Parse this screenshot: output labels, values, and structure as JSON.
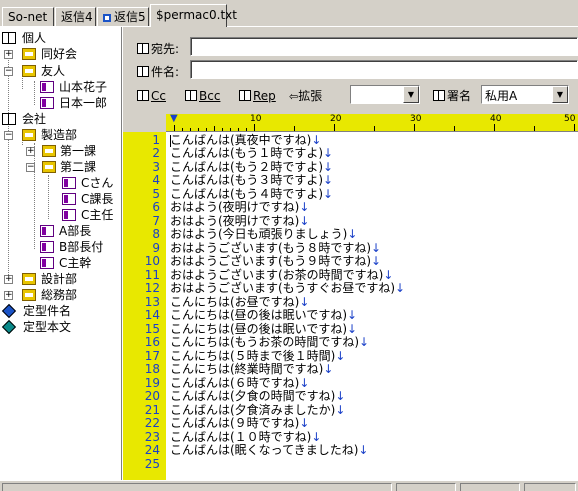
{
  "tabs": [
    {
      "label": "So-net",
      "icon": null
    },
    {
      "label": "返信4",
      "icon": null
    },
    {
      "label": "返信5",
      "icon": "mail-icon"
    },
    {
      "label": "$permac0.txt",
      "icon": null
    }
  ],
  "tree": {
    "personal": "個人",
    "friends_group": "同好会",
    "friend": "友人",
    "yamamoto": "山本花子",
    "nihon": "日本一郎",
    "company": "会社",
    "manufacturing": "製造部",
    "section1": "第一課",
    "section2": "第二課",
    "c_san": "Cさん",
    "c_chief": "C課長",
    "c_lead": "C主任",
    "a_manager": "A部長",
    "b_deputy": "B部長付",
    "c_exec": "C主幹",
    "design": "設計部",
    "general_affairs": "総務部",
    "fixed_subject": "定型件名",
    "fixed_body": "定型本文"
  },
  "header": {
    "to_label": "宛先:",
    "to_value": "",
    "subject_label": "件名:",
    "subject_value": "",
    "cc_label": "Cc",
    "bcc_label": "Bcc",
    "rep_label": "Rep",
    "extend_label": "拡張",
    "extend_value": "",
    "signature_label": "署名",
    "signature_value": "私用A"
  },
  "ruler": {
    "marks": [
      "10",
      "20",
      "30",
      "40",
      "50"
    ]
  },
  "editor": {
    "lines": [
      "こんばんは(真夜中ですね)",
      "こんばんは(もう１時ですよ)",
      "こんばんは(もう２時ですよ)",
      "こんばんは(もう３時ですよ)",
      "こんばんは(もう４時ですよ)",
      "おはよう(夜明けですね)",
      "おはよう(夜明けですね)",
      "おはよう(今日も頑張りましょう)",
      "おはようございます(もう８時ですね)",
      "おはようございます(もう９時ですね)",
      "おはようございます(お茶の時間ですね)",
      "おはようございます(もうすぐお昼ですね)",
      "こんにちは(お昼ですね)",
      "こんにちは(昼の後は眠いですね)",
      "こんにちは(昼の後は眠いですね)",
      "こんにちは(もうお茶の時間ですね)",
      "こんにちは(５時まで後１時間)",
      "こんにちは(終業時間ですね)",
      "こんばんは(６時ですね)",
      "こんばんは(夕食の時間ですね)",
      "こんばんは(夕食済みましたか)",
      "こんばんは(９時ですね)",
      "こんばんは(１０時ですね)",
      "こんばんは(眠くなってきましたね)",
      ""
    ],
    "line_numbers": [
      "1",
      "2",
      "3",
      "4",
      "5",
      "6",
      "7",
      "8",
      "9",
      "10",
      "11",
      "12",
      "13",
      "14",
      "15",
      "16",
      "17",
      "18",
      "19",
      "20",
      "21",
      "22",
      "23",
      "24",
      "25"
    ],
    "eol": "↓"
  }
}
